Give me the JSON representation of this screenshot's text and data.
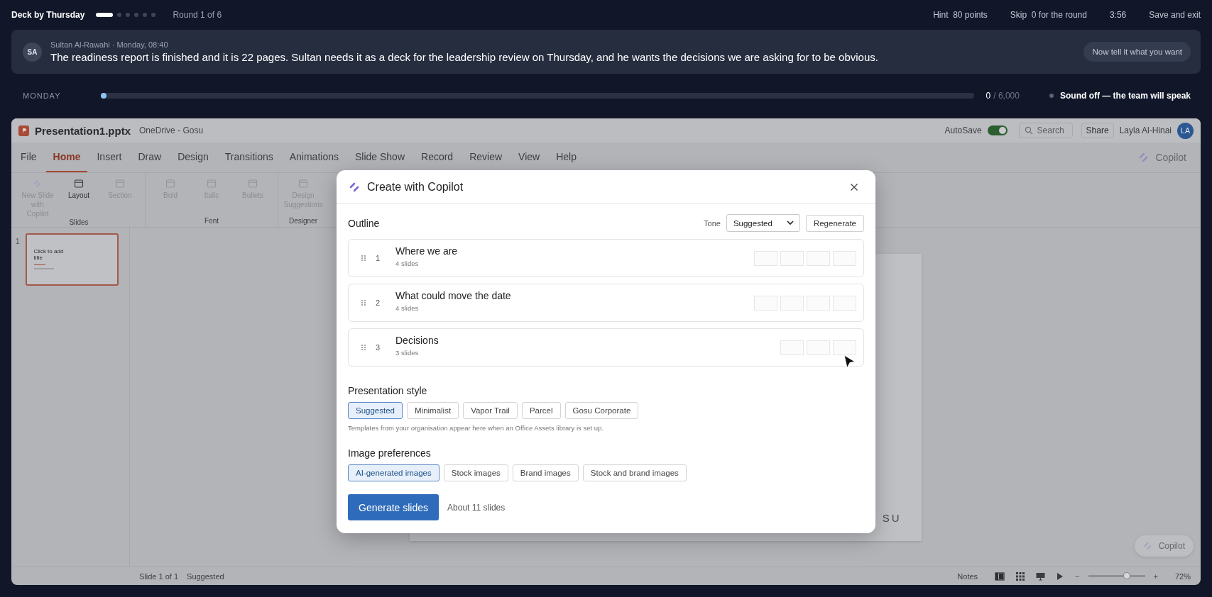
{
  "game": {
    "title": "Deck by Thursday",
    "rounds": [
      {
        "selected": true
      },
      {
        "selected": false
      },
      {
        "selected": false
      },
      {
        "selected": false
      },
      {
        "selected": false
      },
      {
        "selected": false
      }
    ],
    "round_label": "Round 1 of 6",
    "hint": {
      "label": "Hint",
      "value": "80 points"
    },
    "skip": {
      "label": "Skip",
      "value": "0 for the round"
    },
    "timer": "3:56",
    "exit": "Save and exit"
  },
  "message": {
    "initials": "SA",
    "meta": "Sultan Al-Rawahi · Monday, 08:40",
    "text": "The readiness report is finished and it is 22 pages. Sultan needs it as a deck for the leadership review on Thursday, and he wants the decisions we are asking for to be obvious.",
    "action": "Now tell it what you want"
  },
  "progress": {
    "day": "MONDAY",
    "level": 0,
    "score": "0",
    "total": "/ 6,000",
    "sound": "Sound off — the team will speak"
  },
  "app": {
    "file": "Presentation1.pptx",
    "location": "OneDrive - Gosu",
    "autosave": {
      "label": "AutoSave",
      "on": true
    },
    "search": {
      "placeholder": "Search"
    },
    "share": "Share",
    "user": "Layla Al-Hinai",
    "user_initials": "LA",
    "tabs": [
      {
        "label": "File",
        "selected": false
      },
      {
        "label": "Home",
        "selected": true
      },
      {
        "label": "Insert",
        "selected": false
      },
      {
        "label": "Draw",
        "selected": false
      },
      {
        "label": "Design",
        "selected": false
      },
      {
        "label": "Transitions",
        "selected": false
      },
      {
        "label": "Animations",
        "selected": false
      },
      {
        "label": "Slide Show",
        "selected": false
      },
      {
        "label": "Record",
        "selected": false
      },
      {
        "label": "Review",
        "selected": false
      },
      {
        "label": "View",
        "selected": false
      },
      {
        "label": "Help",
        "selected": false
      }
    ],
    "copilot": "Copilot",
    "ribbon_groups": [
      {
        "name": "Slides",
        "items": [
          {
            "label": "New Slide with Copilot",
            "kind": "copilot",
            "disabled": true
          },
          {
            "label": "Layout",
            "kind": "panel",
            "disabled": false
          },
          {
            "label": "Section",
            "kind": "panel",
            "disabled": true
          }
        ]
      },
      {
        "name": "Font",
        "items": [
          {
            "label": "Bold",
            "kind": "panel",
            "disabled": true
          },
          {
            "label": "Italic",
            "kind": "panel",
            "disabled": true
          },
          {
            "label": "Bullets",
            "kind": "panel",
            "disabled": true
          }
        ]
      },
      {
        "name": "Designer",
        "items": [
          {
            "label": "Design Suggestions",
            "kind": "panel",
            "disabled": true
          }
        ]
      }
    ],
    "slides": [
      {
        "number": "1",
        "title": "Click to add title",
        "selected": true
      }
    ],
    "canvas_text": "SU",
    "status": {
      "slide": "Slide 1 of 1",
      "design": "Suggested",
      "notes": "Notes",
      "zoom_out": "−",
      "zoom_slider": {
        "level": 0.68
      },
      "zoom_in": "+",
      "zoom": "72%"
    },
    "floating_copilot": "Copilot"
  },
  "dialog": {
    "title": "Create with Copilot",
    "outline_label": "Outline",
    "tone_label": "Tone",
    "tone": "Suggested",
    "regenerate": "Regenerate",
    "sections": [
      {
        "number": "1",
        "title": "Where we are",
        "count": "4 slides",
        "thumbnails": [
          {
            "kind": "blank"
          },
          {
            "kind": "blank"
          },
          {
            "kind": "blank"
          },
          {
            "kind": "blank"
          }
        ]
      },
      {
        "number": "2",
        "title": "What could move the date",
        "count": "4 slides",
        "thumbnails": [
          {
            "kind": "blank"
          },
          {
            "kind": "blank"
          },
          {
            "kind": "blank"
          },
          {
            "kind": "blank"
          }
        ]
      },
      {
        "number": "3",
        "title": "Decisions",
        "count": "3 slides",
        "thumbnails": [
          {
            "kind": "blank"
          },
          {
            "kind": "blank"
          },
          {
            "kind": "blank"
          }
        ]
      }
    ],
    "style_label": "Presentation style",
    "styles": [
      {
        "label": "Suggested",
        "selected": true
      },
      {
        "label": "Minimalist",
        "selected": false
      },
      {
        "label": "Vapor Trail",
        "selected": false
      },
      {
        "label": "Parcel",
        "selected": false
      },
      {
        "label": "Gosu Corporate",
        "selected": false
      }
    ],
    "style_note": "Templates from your organisation appear here when an Office Assets library is set up.",
    "image_label": "Image preferences",
    "images": [
      {
        "label": "AI-generated images",
        "selected": true
      },
      {
        "label": "Stock images",
        "selected": false
      },
      {
        "label": "Brand images",
        "selected": false
      },
      {
        "label": "Stock and brand images",
        "selected": false
      }
    ],
    "generate": "Generate slides",
    "estimate": "About 11 slides"
  }
}
